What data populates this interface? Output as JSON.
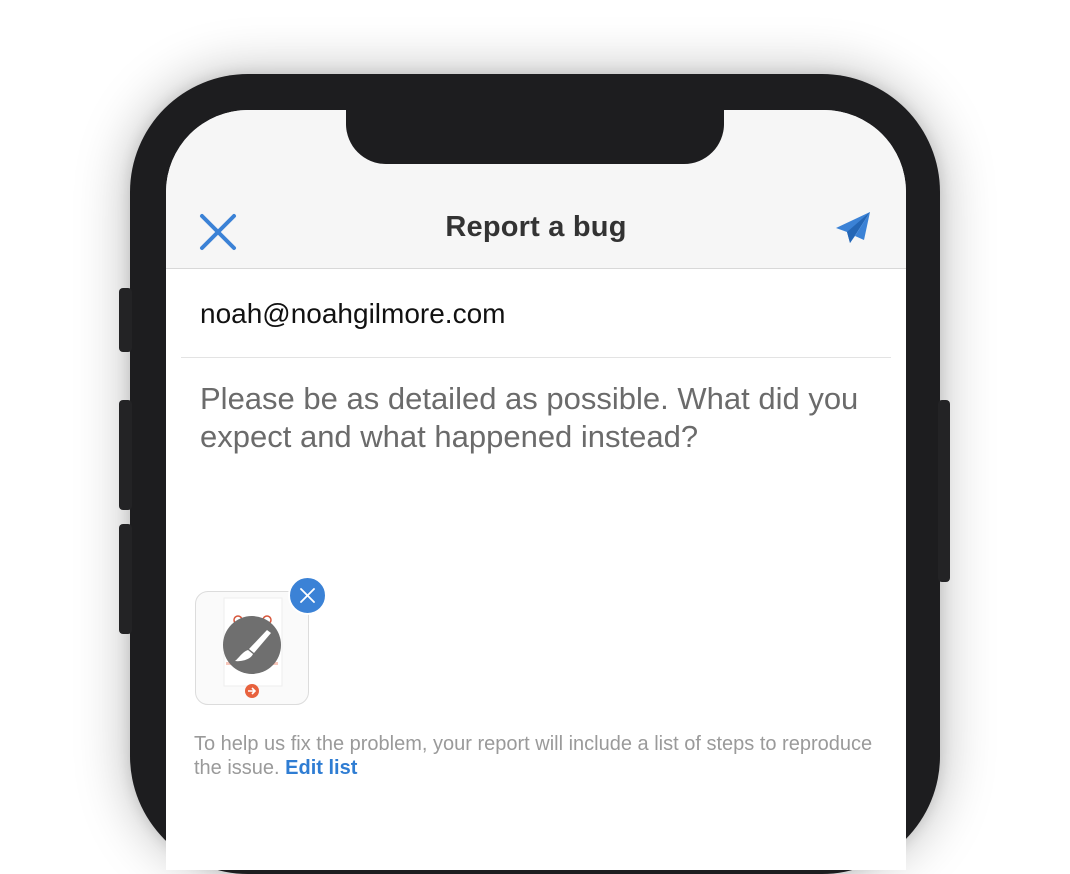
{
  "navbar": {
    "title": "Report a bug",
    "close_icon": "close-icon",
    "send_icon": "paper-plane-icon"
  },
  "form": {
    "email": "noah@noahgilmore.com",
    "description_placeholder": "Please be as detailed as possible. What did you expect and what happened instead?"
  },
  "attachment": {
    "icon": "paintbrush-icon",
    "remove_icon": "close-icon"
  },
  "footer": {
    "note": "To help us fix the problem, your report will include a list of steps to reproduce the issue.",
    "edit_link": "Edit list"
  },
  "colors": {
    "accent": "#3b82d6",
    "link": "#2f7dd3",
    "placeholder": "#6b6b6b",
    "navbar_bg": "#f6f6f6"
  }
}
